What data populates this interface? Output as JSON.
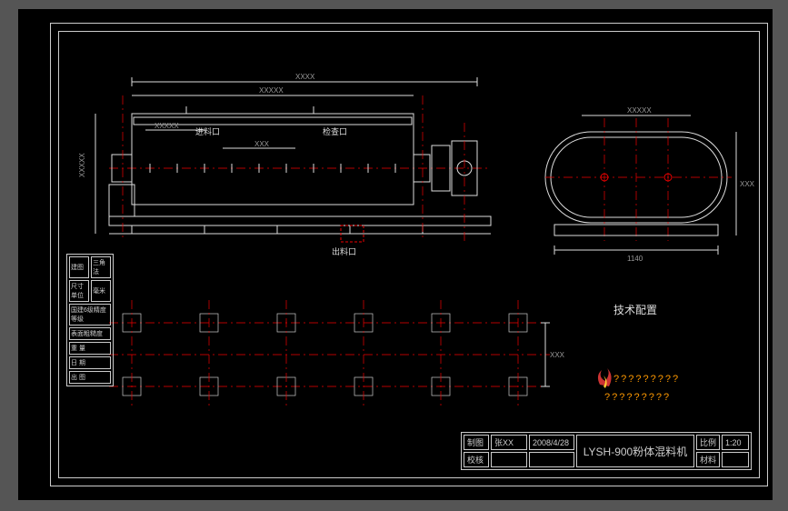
{
  "frame": {
    "section_label": "技术配置",
    "watermark": "?????????"
  },
  "labels": {
    "inlet": "进料口",
    "outlet": "检查口",
    "bottom": "出料口"
  },
  "dimensions": {
    "top_dim": "XXXX",
    "inner_dim": "XXXXX",
    "left_dim": "XXXXX",
    "mid_dim": "XXX",
    "side_dim": "XXXXX",
    "end_width": "1140",
    "end_height": "XXX",
    "plan_height": "XXX"
  },
  "title_block": {
    "row1_c1": "制图",
    "row1_c2": "张XX",
    "row1_c3": "2008/4/28",
    "title": "LYSH-900粉体混料机",
    "scale_label": "比例",
    "scale": "1:20",
    "row2_c1": "校核",
    "material_label": "材料",
    "material": ""
  },
  "left_block": {
    "r1a": "建图",
    "r1b": "三角法",
    "r1c": "尺寸单位",
    "r1d": "毫米",
    "r2": "国建6级精度等级",
    "r3": "表面粗糙度",
    "r4": "重 量",
    "r5": "日 期",
    "r6": "出 图"
  },
  "chart_data": {
    "type": "engineering-drawing",
    "views": [
      {
        "name": "side-elevation",
        "position": "top-left",
        "features": [
          "trough-body",
          "shaft",
          "drive-coupling",
          "inlet-port",
          "inspection-port",
          "outlet-port",
          "base-frame"
        ]
      },
      {
        "name": "end-elevation",
        "position": "top-right",
        "features": [
          "twin-shaft-rounded-housing",
          "two-shafts",
          "base"
        ],
        "width_dim": "1140"
      },
      {
        "name": "foundation-plan",
        "position": "bottom-left",
        "features": [
          "anchor-bolts-grid"
        ],
        "grid": {
          "rows": 2,
          "cols": 6
        }
      }
    ]
  }
}
